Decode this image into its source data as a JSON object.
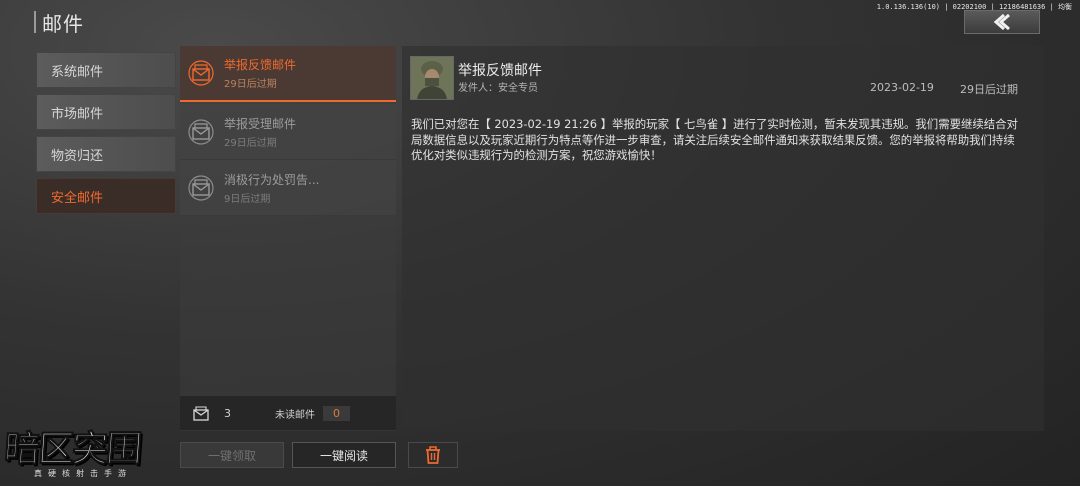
{
  "header": {
    "title": "邮件",
    "version": "1.0.136.136(10) | 02202100 | 12186481636 | 均衡"
  },
  "categories": [
    {
      "label": "系统邮件",
      "active": false
    },
    {
      "label": "市场邮件",
      "active": false
    },
    {
      "label": "物资归还",
      "active": false
    },
    {
      "label": "安全邮件",
      "active": true
    }
  ],
  "mails": [
    {
      "title": "举报反馈邮件",
      "expire": "29日后过期",
      "selected": true
    },
    {
      "title": "举报受理邮件",
      "expire": "29日后过期",
      "selected": false
    },
    {
      "title": "消极行为处罚告...",
      "expire": "9日后过期",
      "selected": false
    }
  ],
  "list_footer": {
    "total": "3",
    "unread_label": "未读邮件",
    "unread_count": "0"
  },
  "detail": {
    "title": "举报反馈邮件",
    "sender": "发件人：安全专员",
    "date": "2023-02-19",
    "expire": "29日后过期",
    "body": "我们已对您在【 2023-02-19 21:26 】举报的玩家【 七鸟雀 】进行了实时检测，暂未发现其违规。我们需要继续结合对局数据信息以及玩家近期行为特点等作进一步审查，请关注后续安全邮件通知来获取结果反馈。您的举报将帮助我们持续优化对类似违规行为的检测方案，祝您游戏愉快！"
  },
  "buttons": {
    "claim_all": "一键领取",
    "read_all": "一键阅读"
  },
  "logo": {
    "main": "暗区突围",
    "sub": "真硬核射击手游"
  },
  "colors": {
    "accent": "#f06a2e",
    "active_bg": "#3a2d28"
  },
  "icons": [
    "back-arrow-icon",
    "envelope-icon",
    "mail-count-icon",
    "trash-icon"
  ]
}
